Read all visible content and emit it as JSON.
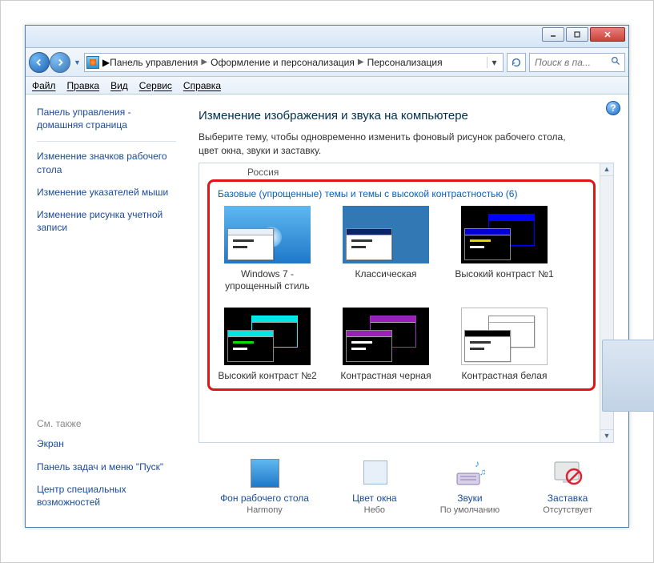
{
  "titlebar": {},
  "breadcrumb": {
    "items": [
      "Панель управления",
      "Оформление и персонализация",
      "Персонализация"
    ]
  },
  "search": {
    "placeholder": "Поиск в па..."
  },
  "menu": {
    "items": [
      "Файл",
      "Правка",
      "Вид",
      "Сервис",
      "Справка"
    ]
  },
  "sidebar": {
    "home": "Панель управления - домашняя страница",
    "links": [
      "Изменение значков рабочего стола",
      "Изменение указателей мыши",
      "Изменение рисунка учетной записи"
    ],
    "seealso_label": "См. также",
    "seealso": [
      "Экран",
      "Панель задач и меню \"Пуск\"",
      "Центр специальных возможностей"
    ]
  },
  "main": {
    "heading": "Изменение изображения и звука на компьютере",
    "description": "Выберите тему, чтобы одновременно изменить фоновый рисунок рабочего стола, цвет окна, звуки и заставку.",
    "russia": "Россия",
    "section_title": "Базовые (упрощенные) темы и темы с высокой контрастностью (6)",
    "themes": [
      "Windows 7 - упрощенный стиль",
      "Классическая",
      "Высокий контраст №1",
      "Высокий контраст №2",
      "Контрастная черная",
      "Контрастная белая"
    ]
  },
  "bottom": {
    "items": [
      {
        "label": "Фон рабочего стола",
        "sub": "Harmony"
      },
      {
        "label": "Цвет окна",
        "sub": "Небо"
      },
      {
        "label": "Звуки",
        "sub": "По умолчанию"
      },
      {
        "label": "Заставка",
        "sub": "Отсутствует"
      }
    ]
  }
}
